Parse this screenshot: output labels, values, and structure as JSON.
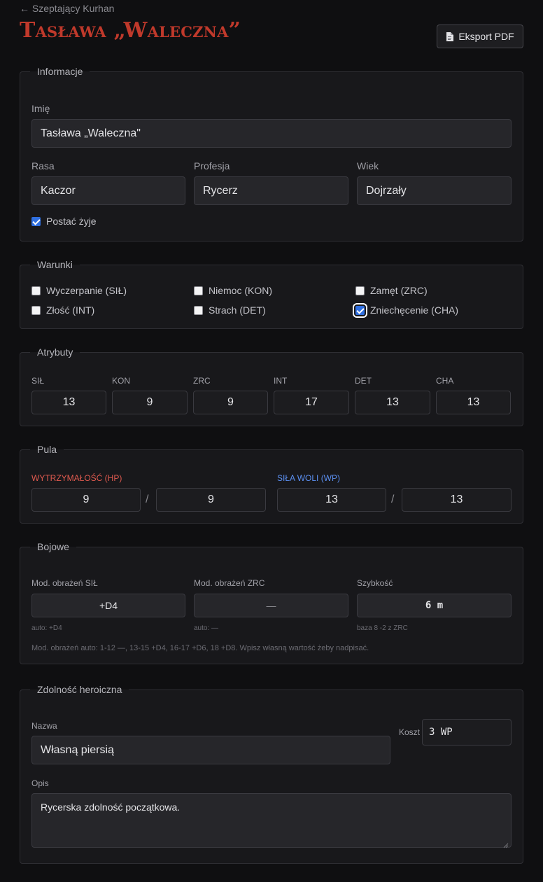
{
  "nav": {
    "back_label": "← Szeptający Kurhan"
  },
  "header": {
    "title": "Tasława „Waleczna”",
    "export_label": "Eksport PDF"
  },
  "info": {
    "legend": "Informacje",
    "name_label": "Imię",
    "name_value": "Tasława „Waleczna\"",
    "race_label": "Rasa",
    "race_value": "Kaczor",
    "profession_label": "Profesja",
    "profession_value": "Rycerz",
    "age_label": "Wiek",
    "age_value": "Dojrzały",
    "alive_label": "Postać żyje",
    "alive_checked": true
  },
  "conditions": {
    "legend": "Warunki",
    "items": [
      {
        "label": "Wyczerpanie (SIŁ)",
        "checked": false
      },
      {
        "label": "Niemoc (KON)",
        "checked": false
      },
      {
        "label": "Zamęt (ZRC)",
        "checked": false
      },
      {
        "label": "Złość (INT)",
        "checked": false
      },
      {
        "label": "Strach (DET)",
        "checked": false
      },
      {
        "label": "Zniechęcenie (CHA)",
        "checked": true
      }
    ]
  },
  "attributes": {
    "legend": "Atrybuty",
    "items": [
      {
        "label": "SIŁ",
        "value": "13"
      },
      {
        "label": "KON",
        "value": "9"
      },
      {
        "label": "ZRC",
        "value": "9"
      },
      {
        "label": "INT",
        "value": "17"
      },
      {
        "label": "DET",
        "value": "13"
      },
      {
        "label": "CHA",
        "value": "13"
      }
    ]
  },
  "pool": {
    "legend": "Pula",
    "hp_label": "WYTRZYMAŁOŚĆ (HP)",
    "hp_current": "9",
    "hp_max": "9",
    "wp_label": "SIŁA WOLI (WP)",
    "wp_current": "13",
    "wp_max": "13",
    "separator": "/",
    "hp_color": "#e05a4f",
    "wp_color": "#5b8ff0"
  },
  "combat": {
    "legend": "Bojowe",
    "str_mod_label": "Mod. obrażeń SIŁ",
    "str_mod_value": "+D4",
    "str_mod_hint": "auto: +D4",
    "agl_mod_label": "Mod. obrażeń ZRC",
    "agl_mod_value": "—",
    "agl_mod_hint": "auto: —",
    "speed_label": "Szybkość",
    "speed_value": "6 m",
    "speed_hint": "baza 8 -2 z ZRC",
    "note": "Mod. obrażeń auto: 1-12 —, 13-15 +D4, 16-17 +D6, 18 +D8. Wpisz własną wartość żeby nadpisać."
  },
  "heroic": {
    "legend": "Zdolność heroiczna",
    "name_label": "Nazwa",
    "name_value": "Własną piersią",
    "cost_label": "Koszt",
    "cost_value": "3 WP",
    "desc_label": "Opis",
    "desc_value": "Rycerska zdolność początkowa."
  }
}
